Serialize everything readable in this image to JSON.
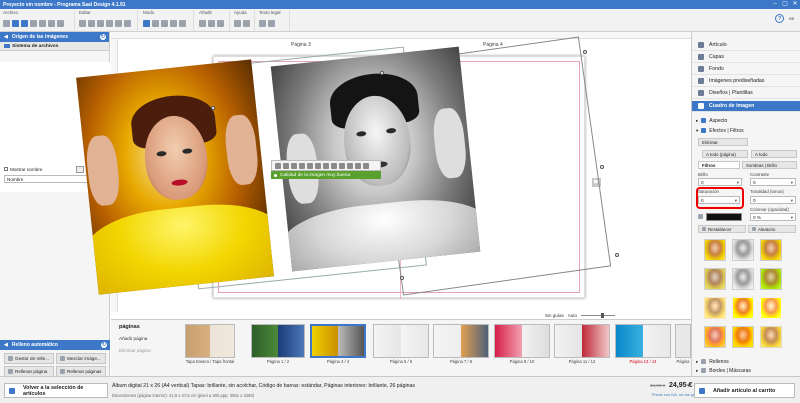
{
  "window": {
    "title": "Proyecto sin nombre - Programa Saal Design 4.1.91",
    "controls": [
      "–",
      "▢",
      "✕"
    ]
  },
  "ribbon": {
    "groups": [
      "Archivo",
      "Editar",
      "Modo",
      "Añadir",
      "Ayuda",
      "Texto legal"
    ],
    "lang": "es"
  },
  "left_panel": {
    "header": "Origen de las imágenes",
    "tab": "Sistema de archivos",
    "show_label": "Mostrar nombre",
    "sort_value": "Nombre",
    "bottom_header": "Relleno automático",
    "buttons": [
      "Gestor de relle...",
      "Mezclar imáge...",
      "Rellenar página",
      "Rellenar páginas"
    ]
  },
  "canvas": {
    "page_left": "Página 3",
    "page_right": "Página 4",
    "quality": "Calidad de la imagen muy buena"
  },
  "zoom": {
    "guides": "Sin guías",
    "mode": "Auto"
  },
  "pages_strip": {
    "title": "páginas",
    "add": "Añadir página",
    "remove": "Eliminar página",
    "thumbs": [
      {
        "label": "Tapa trasera / Tapa frontal",
        "red": false
      },
      {
        "label": "Página 1 / 2",
        "red": false
      },
      {
        "label": "Página 3 / 4",
        "red": false
      },
      {
        "label": "Página 5 / 6",
        "red": false
      },
      {
        "label": "Página 7 / 8",
        "red": false
      },
      {
        "label": "Página 9 / 10",
        "red": false
      },
      {
        "label": "Página 11 / 12",
        "red": false
      },
      {
        "label": "Página 13 / 14",
        "red": true
      },
      {
        "label": "Página",
        "red": false
      }
    ]
  },
  "right_panel": {
    "items": [
      "Artículo",
      "Capas",
      "Fondo",
      "Imágenes prediseñadas",
      "Diseños | Plantillas",
      "Cuadro de imagen"
    ],
    "aspect": "Aspecto",
    "effects": "Efectos | Filtros",
    "delete": "Eliminar",
    "to_all_page": "A todo (página)",
    "to_all": "A todo",
    "tab_filters": "Filtros",
    "tab_shadows": "Sombras | Brillo",
    "brightness_label": "Brillo",
    "brightness": "0",
    "contrast_label": "Contraste",
    "contrast": "0",
    "saturation_label": "Saturación",
    "saturation": "0",
    "tonality_label": "Tonalidad (tonos)",
    "tonality": "0",
    "colorize_label": "Colorear (opacidad)",
    "colorize": "0 %",
    "reset": "Restablecer",
    "random": "Aleatorio",
    "fills": "Rellenos",
    "borders": "Bordes | Máscaras"
  },
  "bottom": {
    "back": "Volver a la selección de artículos",
    "desc1": "Álbum digital 21 x 26 (A4 vertical) Tapas: brillante, sin acolchar, Código de barras: estándar, Páginas interiores: brillante, 26 páginas",
    "desc2": "Dimensiones (página interior): 41,6 x 27,6 cm (pixel a 300 ppp: 3931 x 3260)",
    "old_price": "34,95 €",
    "price": "24,95 €",
    "price_note": "Precio con IVA, sin los gastos de envío",
    "cart": "Añadir artículo al carrito"
  },
  "colors": {
    "accent": "#3d78c8",
    "quality": "#5aa02c",
    "highlight": "#e00000"
  }
}
